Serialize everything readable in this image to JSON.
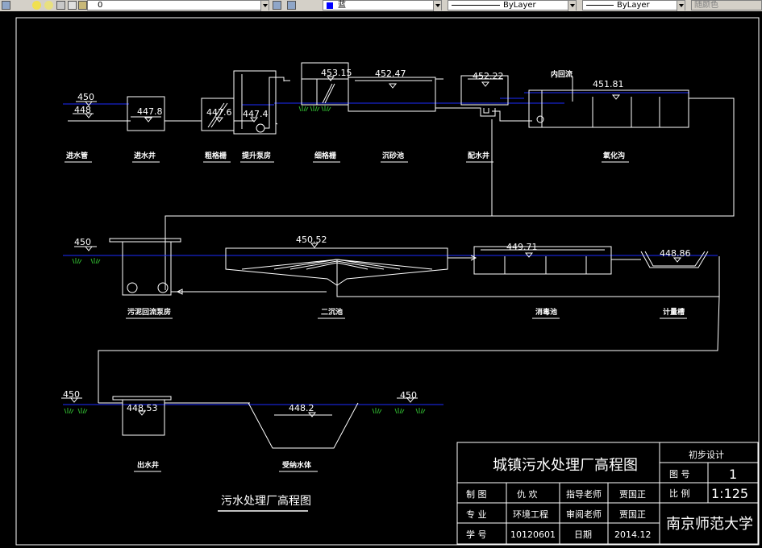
{
  "toolbar": {
    "layer_value": "0",
    "color_value": "蓝",
    "linetype_value": "ByLayer",
    "lineweight_value": "ByLayer",
    "plotstyle_value": "随颜色"
  },
  "drawing": {
    "levels": {
      "inlet_pipe_ground": "450",
      "inlet_pipe_water": "448",
      "intake_well": "447.8",
      "coarse_screen": "447.6",
      "lift_pump": "447.4",
      "fine_screen": "453.15",
      "grit_chamber": "452.47",
      "distribution_well": "452.22",
      "oxidation_ditch": "451.81",
      "ras_ground": "450",
      "secondary_clarifier": "450.52",
      "disinfection_tank": "449.71",
      "metering_tank": "448.86",
      "outlet_ground": "450",
      "outlet_well": "448.53",
      "receiving_water": "448.2",
      "right_ground": "450"
    },
    "labels": {
      "inlet_pipe": "进水管",
      "intake_well": "进水井",
      "coarse_screen": "粗格栅",
      "lift_pump": "提升泵房",
      "fine_screen": "细格栅",
      "grit_chamber": "沉砂池",
      "distribution_well": "配水井",
      "internal_recycle": "内回流",
      "oxidation_ditch": "氧化沟",
      "ras_pump": "污泥回流泵房",
      "secondary_clarifier": "二沉池",
      "disinfection_tank": "消毒池",
      "metering_tank": "计量槽",
      "outlet_well": "出水井",
      "receiving_water": "受纳水体",
      "drawing_caption": "污水处理厂高程图"
    },
    "title_block": {
      "title": "城镇污水处理厂高程图",
      "stage": "初步设计",
      "drawing_no_label": "图  号",
      "drawing_no": "1",
      "scale_label": "比  例",
      "scale": "1:125",
      "drawn_by_label": "制  图",
      "drawn_by": "仇  欢",
      "advisor_label": "指导老师",
      "advisor": "贾国正",
      "major_label": "专  业",
      "major": "环境工程",
      "reviewer_label": "审阅老师",
      "reviewer": "贾国正",
      "student_no_label": "学  号",
      "student_no": "10120601",
      "date_label": "日期",
      "date": "2014.12",
      "university": "南京师范大学"
    }
  }
}
